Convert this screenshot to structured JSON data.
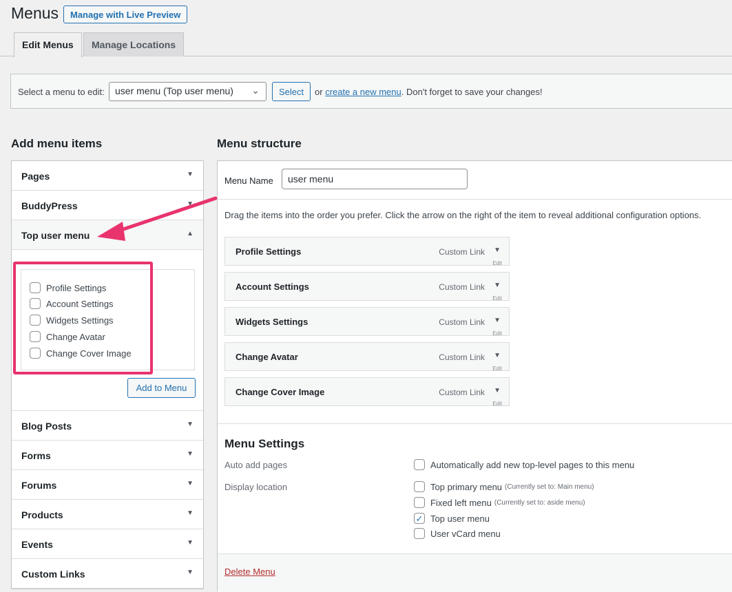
{
  "header": {
    "title": "Menus",
    "live_preview_label": "Manage with Live Preview"
  },
  "tabs": [
    {
      "label": "Edit Menus",
      "active": true
    },
    {
      "label": "Manage Locations",
      "active": false
    }
  ],
  "select_bar": {
    "label": "Select a menu to edit:",
    "selected_value": "user menu (Top user menu)",
    "select_button": "Select",
    "hint_prefix": "or",
    "create_link": "create a new menu",
    "hint_suffix": ". Don't forget to save your changes!"
  },
  "add_items": {
    "heading": "Add menu items",
    "sections": [
      "Pages",
      "BuddyPress",
      "Top user menu",
      "Blog Posts",
      "Forms",
      "Forums",
      "Products",
      "Events",
      "Custom Links"
    ],
    "open_section": "Top user menu",
    "checklist": [
      "Profile Settings",
      "Account Settings",
      "Widgets Settings",
      "Change Avatar",
      "Change Cover Image"
    ],
    "add_button": "Add to Menu"
  },
  "structure": {
    "heading": "Menu structure",
    "name_label": "Menu Name",
    "name_value": "user menu",
    "drag_hint": "Drag the items into the order you prefer. Click the arrow on the right of the item to reveal additional configuration options.",
    "items": [
      {
        "title": "Profile Settings",
        "type": "Custom Link",
        "edit": "Edit"
      },
      {
        "title": "Account Settings",
        "type": "Custom Link",
        "edit": "Edit"
      },
      {
        "title": "Widgets Settings",
        "type": "Custom Link",
        "edit": "Edit"
      },
      {
        "title": "Change Avatar",
        "type": "Custom Link",
        "edit": "Edit"
      },
      {
        "title": "Change Cover Image",
        "type": "Custom Link",
        "edit": "Edit"
      }
    ]
  },
  "settings": {
    "heading": "Menu Settings",
    "auto_add_label": "Auto add pages",
    "auto_add_option": "Automatically add new top-level pages to this menu",
    "display_label": "Display location",
    "locations": [
      {
        "name": "Top primary menu",
        "note": "(Currently set to: Main menu)",
        "checked": false
      },
      {
        "name": "Fixed left menu",
        "note": "(Currently set to: aside menu)",
        "checked": false
      },
      {
        "name": "Top user menu",
        "note": "",
        "checked": true
      },
      {
        "name": "User vCard menu",
        "note": "",
        "checked": false
      }
    ],
    "delete_label": "Delete Menu"
  },
  "colors": {
    "accent": "#2271b1",
    "annotation": "#e8336d",
    "danger": "#b32d2e"
  },
  "icons": {
    "section_collapsed": "triangle-down-icon",
    "section_open": "triangle-up-icon",
    "select": "chevron-down-icon",
    "checked": "checkmark-icon"
  }
}
